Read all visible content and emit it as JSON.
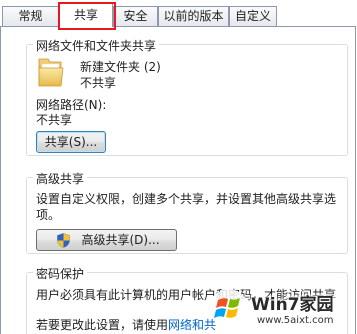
{
  "tabs": [
    {
      "label": "常规"
    },
    {
      "label": "共享"
    },
    {
      "label": "安全"
    },
    {
      "label": "以前的版本"
    },
    {
      "label": "自定义"
    }
  ],
  "active_tab": "共享",
  "network_file_sharing": {
    "title": "网络文件和文件夹共享",
    "folder_name": "新建文件夹 (2)",
    "folder_status": "不共享",
    "network_path_label": "网络路径(N):",
    "network_path_value": "不共享",
    "share_button": "共享(S)..."
  },
  "advanced_sharing": {
    "title": "高级共享",
    "description_line1": "设置自定义权限，创建多个共享，并设置其他高级共享选",
    "description_line2": "项。",
    "button": "高级共享(D)..."
  },
  "password_protection": {
    "title": "密码保护",
    "line1": "用户必须具有此计算机的用户帐户和密码，才能访问共享",
    "line2_prefix": "若要更改此设置，请使用",
    "line2_link": "网络和共"
  },
  "watermark": {
    "name": "Win7家园",
    "url": "www.5aixt.com"
  },
  "colors": {
    "highlight_box": "#e8191c",
    "link": "#0066cc",
    "group_border": "#d5dfe5",
    "tab_border": "#8a99b0"
  }
}
